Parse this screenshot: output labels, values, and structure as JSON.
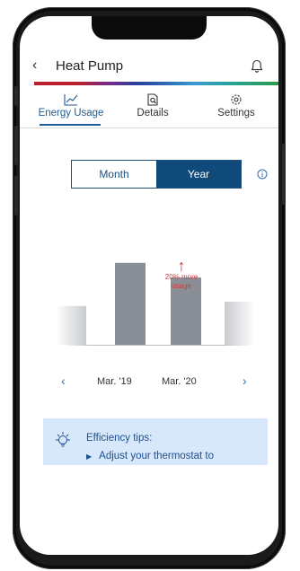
{
  "header": {
    "back_icon": "chevron-left-icon",
    "title": "Heat Pump",
    "bell_icon": "bell-icon"
  },
  "tabs": [
    {
      "label": "Energy Usage",
      "icon": "line-chart-icon",
      "active": true
    },
    {
      "label": "Details",
      "icon": "document-search-icon",
      "active": false
    },
    {
      "label": "Settings",
      "icon": "gear-icon",
      "active": false
    }
  ],
  "period_toggle": {
    "options": [
      "Month",
      "Year"
    ],
    "selected": "Year"
  },
  "chart_data": {
    "type": "bar",
    "categories": [
      "",
      "Mar. '19",
      "Mar. '20",
      ""
    ],
    "values": [
      45,
      95,
      78,
      50
    ],
    "x_labels_visible": [
      "Mar. '19",
      "Mar. '20"
    ],
    "annotation": {
      "lines": [
        "20% more",
        "usage"
      ],
      "color": "#d23b3b",
      "icon": "arrow-up-icon"
    },
    "bar_color": "#8a8e96",
    "ylim": [
      0,
      100
    ]
  },
  "chart_nav": {
    "prev_icon": "chevron-left-icon",
    "next_icon": "chevron-right-icon"
  },
  "tips": {
    "icon": "lightbulb-icon",
    "title": "Efficiency tips:",
    "items": [
      "Adjust your thermostat to"
    ]
  },
  "colors": {
    "accent": "#1f5b96",
    "selected_bg": "#0f4a7a",
    "tips_bg": "#d7e8fb"
  }
}
